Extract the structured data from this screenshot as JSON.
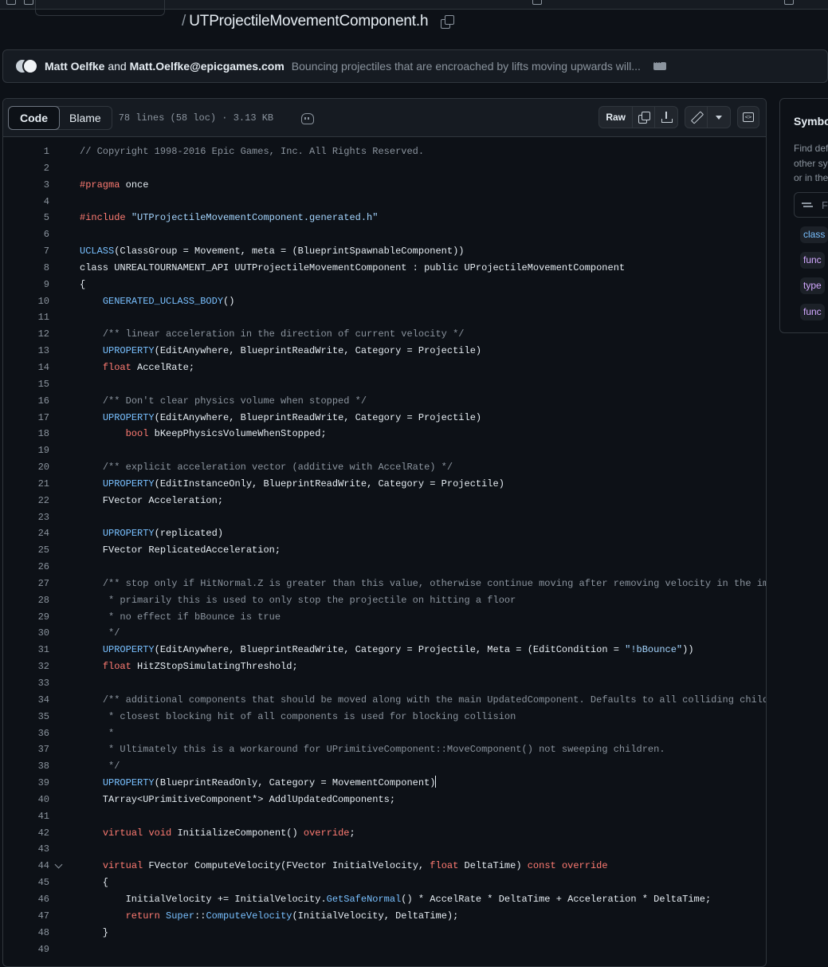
{
  "file": {
    "name": "UTProjectileMovementComponent.h",
    "slash": "/"
  },
  "commit": {
    "author1": "Matt Oelfke",
    "and": "and",
    "author2": "Matt.Oelfke@epicgames.com",
    "message": "Bouncing projectiles that are encroached by lifts moving upwards will..."
  },
  "viewer": {
    "tab_code": "Code",
    "tab_blame": "Blame",
    "meta": "78 lines (58 loc) · 3.13 KB",
    "raw_label": "Raw"
  },
  "symbols": {
    "title": "Symbo",
    "desc": [
      "Find def",
      "other sy",
      "or in the"
    ],
    "filter_placeholder": "Fi",
    "tags": [
      "class",
      "func",
      "type",
      "func"
    ]
  },
  "code_lines": [
    {
      "n": "1",
      "html": "<span class='cm'>// Copyright 1998-2016 Epic Games, Inc. All Rights Reserved.</span>"
    },
    {
      "n": "2",
      "html": ""
    },
    {
      "n": "3",
      "html": "<span class='kw'>#pragma</span> once"
    },
    {
      "n": "4",
      "html": ""
    },
    {
      "n": "5",
      "html": "<span class='kw'>#include</span> <span class='st'>\"UTProjectileMovementComponent.generated.h\"</span>"
    },
    {
      "n": "6",
      "html": ""
    },
    {
      "n": "7",
      "html": "<span class='mc'>UCLASS</span>(ClassGroup = Movement, meta = (BlueprintSpawnableComponent))"
    },
    {
      "n": "8",
      "html": "class UNREALTOURNAMENT_API UUTProjectileMovementComponent : public UProjectileMovementComponent"
    },
    {
      "n": "9",
      "html": "{"
    },
    {
      "n": "10",
      "html": "    <span class='mc'>GENERATED_UCLASS_BODY</span>()"
    },
    {
      "n": "11",
      "html": ""
    },
    {
      "n": "12",
      "html": "    <span class='cm'>/** linear acceleration in the direction of current velocity */</span>"
    },
    {
      "n": "13",
      "html": "    <span class='mc'>UPROPERTY</span>(EditAnywhere, BlueprintReadWrite, Category = Projectile)"
    },
    {
      "n": "14",
      "html": "    <span class='kw'>float</span> AccelRate;"
    },
    {
      "n": "15",
      "html": ""
    },
    {
      "n": "16",
      "html": "    <span class='cm'>/** Don't clear physics volume when stopped */</span>"
    },
    {
      "n": "17",
      "html": "    <span class='mc'>UPROPERTY</span>(EditAnywhere, BlueprintReadWrite, Category = Projectile)"
    },
    {
      "n": "18",
      "html": "        <span class='kw'>bool</span> bKeepPhysicsVolumeWhenStopped;"
    },
    {
      "n": "19",
      "html": ""
    },
    {
      "n": "20",
      "html": "    <span class='cm'>/** explicit acceleration vector (additive with AccelRate) */</span>"
    },
    {
      "n": "21",
      "html": "    <span class='mc'>UPROPERTY</span>(EditInstanceOnly, BlueprintReadWrite, Category = Projectile)"
    },
    {
      "n": "22",
      "html": "    FVector Acceleration;"
    },
    {
      "n": "23",
      "html": ""
    },
    {
      "n": "24",
      "html": "    <span class='mc'>UPROPERTY</span>(replicated)"
    },
    {
      "n": "25",
      "html": "    FVector ReplicatedAcceleration;"
    },
    {
      "n": "26",
      "html": ""
    },
    {
      "n": "27",
      "html": "    <span class='cm'>/** stop only if HitNormal.Z is greater than this value, otherwise continue moving after removing velocity in the impact</span>"
    },
    {
      "n": "28",
      "html": "    <span class='cm'> * primarily this is used to only stop the projectile on hitting a floor</span>"
    },
    {
      "n": "29",
      "html": "    <span class='cm'> * no effect if bBounce is true</span>"
    },
    {
      "n": "30",
      "html": "    <span class='cm'> */</span>"
    },
    {
      "n": "31",
      "html": "    <span class='mc'>UPROPERTY</span>(EditAnywhere, BlueprintReadWrite, Category = Projectile, Meta = (EditCondition = <span class='st'>\"!bBounce\"</span>))"
    },
    {
      "n": "32",
      "html": "    <span class='kw'>float</span> HitZStopSimulatingThreshold;"
    },
    {
      "n": "33",
      "html": ""
    },
    {
      "n": "34",
      "html": "    <span class='cm'>/** additional components that should be moved along with the main UpdatedComponent. Defaults to all colliding children o</span>"
    },
    {
      "n": "35",
      "html": "    <span class='cm'> * closest blocking hit of all components is used for blocking collision</span>"
    },
    {
      "n": "36",
      "html": "    <span class='cm'> *</span>"
    },
    {
      "n": "37",
      "html": "    <span class='cm'> * Ultimately this is a workaround for UPrimitiveComponent::MoveComponent() not sweeping children.</span>"
    },
    {
      "n": "38",
      "html": "    <span class='cm'> */</span>"
    },
    {
      "n": "39",
      "html": "    <span class='mc'>UPROPERTY</span>(BlueprintReadOnly, Category = MovementComponent)<span class='cursor'></span>"
    },
    {
      "n": "40",
      "html": "    TArray&lt;UPrimitiveComponent*&gt; AddlUpdatedComponents;"
    },
    {
      "n": "41",
      "html": ""
    },
    {
      "n": "42",
      "html": "    <span class='kw'>virtual</span> <span class='kw'>void</span> InitializeComponent() <span class='kw'>override</span>;"
    },
    {
      "n": "43",
      "html": ""
    },
    {
      "n": "44",
      "html": "    <span class='kw'>virtual</span> FVector ComputeVelocity(FVector InitialVelocity, <span class='kw'>float</span> DeltaTime) <span class='kw'>const</span> <span class='kw'>override</span>",
      "fold": true
    },
    {
      "n": "45",
      "html": "    {"
    },
    {
      "n": "46",
      "html": "        InitialVelocity += InitialVelocity.<span class='mc'>GetSafeNormal</span>() * AccelRate * DeltaTime + Acceleration * DeltaTime;"
    },
    {
      "n": "47",
      "html": "        <span class='kw'>return</span> <span class='mc'>Super</span>::<span class='mc'>ComputeVelocity</span>(InitialVelocity, DeltaTime);"
    },
    {
      "n": "48",
      "html": "    }"
    },
    {
      "n": "49",
      "html": ""
    }
  ]
}
